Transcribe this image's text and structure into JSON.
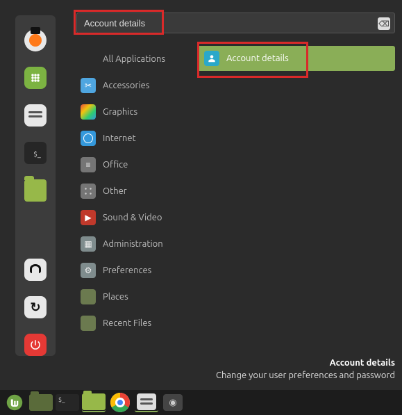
{
  "search": {
    "value": "Account details"
  },
  "favorites": [
    {
      "name": "firefox"
    },
    {
      "name": "software-manager"
    },
    {
      "name": "system-settings"
    },
    {
      "name": "terminal"
    },
    {
      "name": "files"
    },
    {
      "name": "lock-screen"
    },
    {
      "name": "logout"
    },
    {
      "name": "quit"
    }
  ],
  "categories": [
    {
      "label": "All Applications"
    },
    {
      "label": "Accessories"
    },
    {
      "label": "Graphics"
    },
    {
      "label": "Internet"
    },
    {
      "label": "Office"
    },
    {
      "label": "Other"
    },
    {
      "label": "Sound & Video"
    },
    {
      "label": "Administration"
    },
    {
      "label": "Preferences"
    },
    {
      "label": "Places"
    },
    {
      "label": "Recent Files"
    }
  ],
  "results": [
    {
      "label": "Account details"
    }
  ],
  "description": {
    "title": "Account details",
    "subtitle": "Change your user preferences and password"
  },
  "taskbar": [
    {
      "name": "mint-menu"
    },
    {
      "name": "file-manager-dark"
    },
    {
      "name": "terminal"
    },
    {
      "name": "file-manager"
    },
    {
      "name": "chrome"
    },
    {
      "name": "settings"
    },
    {
      "name": "disks"
    }
  ]
}
